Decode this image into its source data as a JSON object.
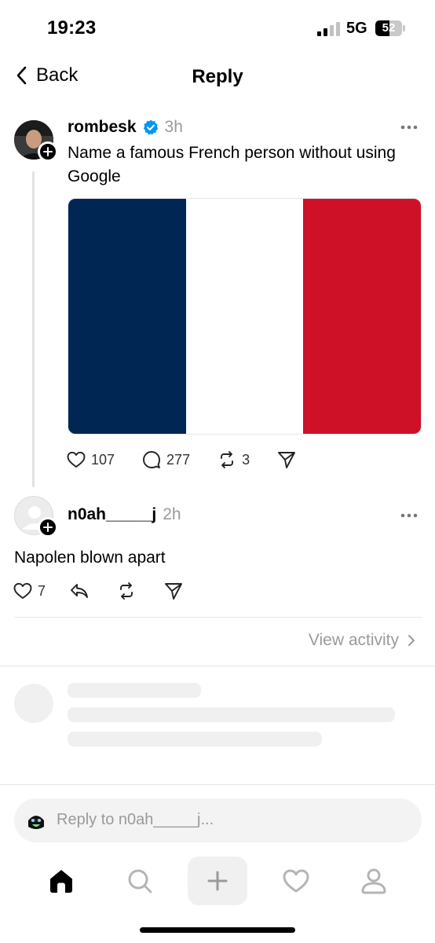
{
  "status_bar": {
    "time": "19:23",
    "network": "5G",
    "battery_level": "52",
    "battery_fraction": 0.52,
    "signal_bars_active": 2,
    "signal_bars_total": 4
  },
  "nav": {
    "back_label": "Back",
    "title": "Reply"
  },
  "post": {
    "username": "rombesk",
    "verified": true,
    "time": "3h",
    "text": "Name a famous French person without using Google",
    "image": {
      "description_colors": [
        "#002654",
        "#ffffff",
        "#ce1126"
      ]
    },
    "likes": "107",
    "comments": "277",
    "reposts": "3"
  },
  "reply": {
    "username": "n0ah_____j",
    "time": "2h",
    "text": "Napolen blown apart",
    "likes": "7"
  },
  "view_activity_label": "View activity",
  "composer": {
    "placeholder": "Reply to n0ah_____j..."
  },
  "tabbar": {
    "items": [
      "home-icon",
      "search-icon",
      "plus-icon",
      "heart-icon",
      "profile-icon"
    ],
    "active": "home-icon"
  },
  "colors": {
    "verified_blue": "#0095f6",
    "muted_text": "#9a9a9a",
    "skeleton": "#f0f0f0"
  }
}
